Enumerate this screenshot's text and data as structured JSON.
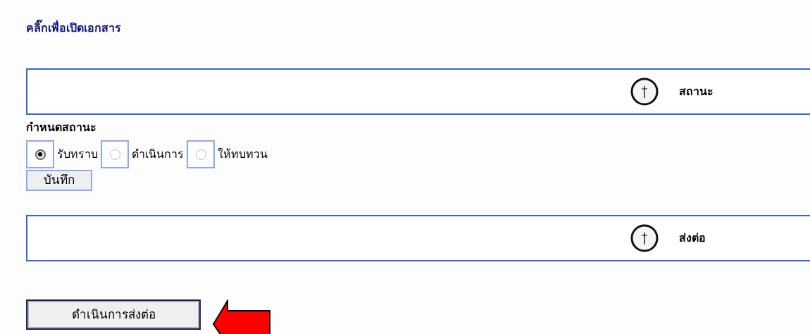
{
  "link": "คลิ๊กเพื่อเปิดเอกสาร",
  "status_panel": {
    "label": "สถานะ"
  },
  "set_status": {
    "heading": "กำหนดสถานะ",
    "options": [
      {
        "label": "รับทราบ",
        "selected": true
      },
      {
        "label": "ดำเนินการ",
        "selected": false
      },
      {
        "label": "ให้ทบทวน",
        "selected": false
      }
    ],
    "save_button": "บันทึก"
  },
  "forward_panel": {
    "label": "ส่งต่อ"
  },
  "forward_button": "ดำเนินการส่งต่อ"
}
